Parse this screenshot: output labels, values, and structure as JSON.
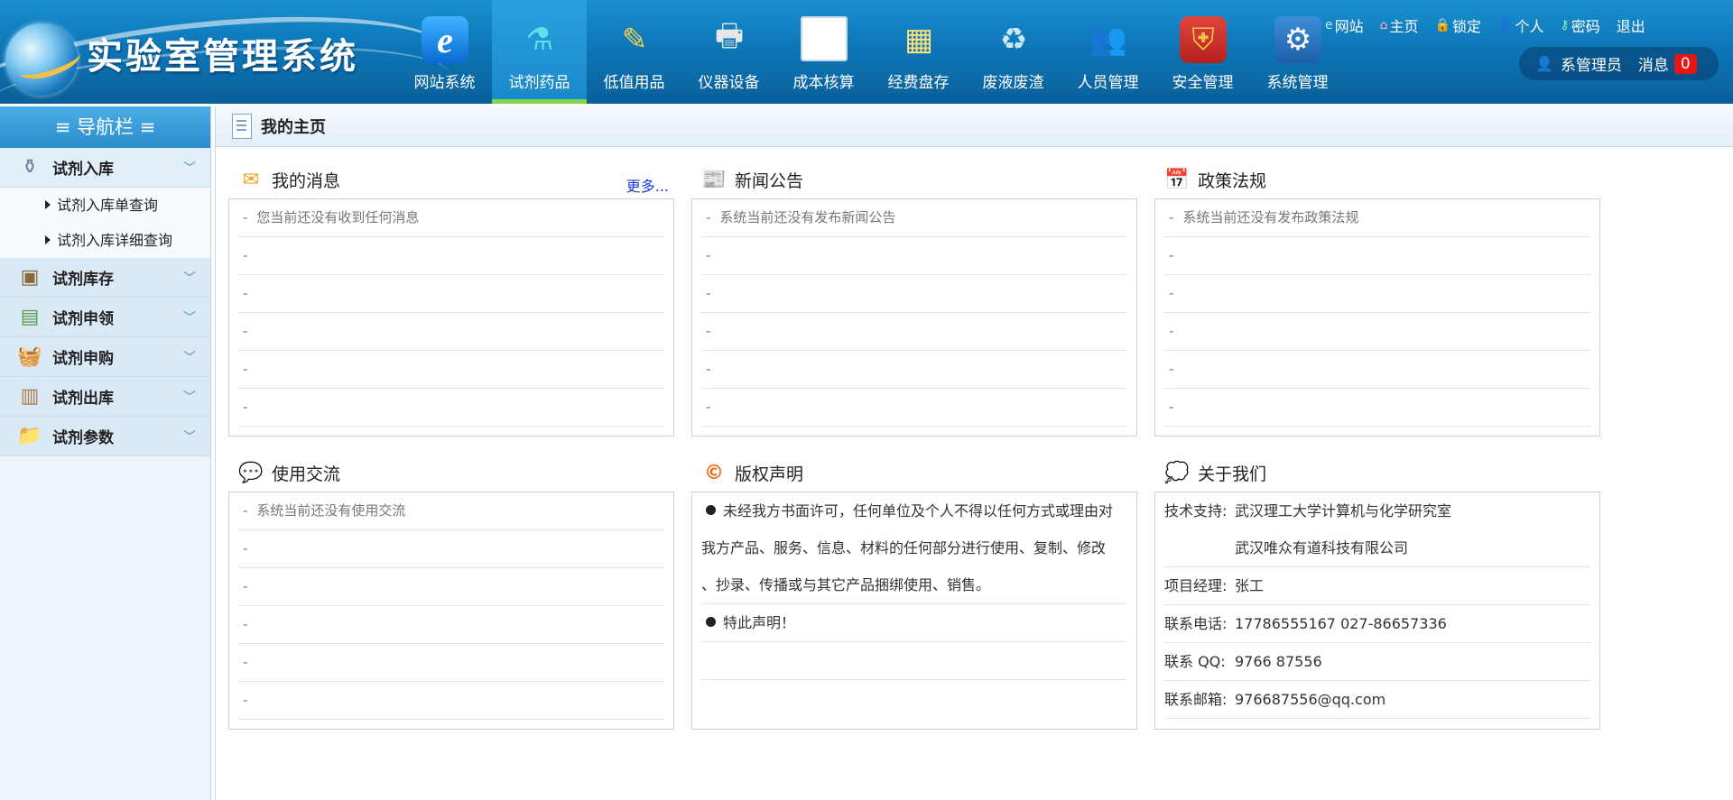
{
  "app": {
    "title": "实验室管理系统"
  },
  "main_nav": [
    {
      "label": "网站系统",
      "icon": "ie-browser-icon"
    },
    {
      "label": "试剂药品",
      "icon": "flask-icon",
      "active": true
    },
    {
      "label": "低值用品",
      "icon": "dropper-icon"
    },
    {
      "label": "仪器设备",
      "icon": "instrument-icon"
    },
    {
      "label": "成本核算",
      "icon": "spreadsheet-icon"
    },
    {
      "label": "经费盘存",
      "icon": "money-calculator-icon"
    },
    {
      "label": "废液废渣",
      "icon": "recycle-bin-icon"
    },
    {
      "label": "人员管理",
      "icon": "people-icon"
    },
    {
      "label": "安全管理",
      "icon": "shield-icon"
    },
    {
      "label": "系统管理",
      "icon": "gear-icon"
    }
  ],
  "top_links": [
    {
      "label": "网站",
      "icon": "ie-small-icon"
    },
    {
      "label": "主页",
      "icon": "home-icon"
    },
    {
      "label": "锁定",
      "icon": "lock-icon"
    },
    {
      "label": "个人",
      "icon": "person-icon"
    },
    {
      "label": "密码",
      "icon": "key-icon"
    },
    {
      "label": "退出",
      "icon": ""
    }
  ],
  "user": {
    "name": "系管理员",
    "message_label": "消息",
    "message_count": "0"
  },
  "sidebar": {
    "title": "≡ 导航栏 ≡",
    "groups": [
      {
        "label": "试剂入库",
        "icon": "reagent-in-icon",
        "open": true,
        "items": [
          "试剂入库单查询",
          "试剂入库详细查询"
        ]
      },
      {
        "label": "试剂库存",
        "icon": "inventory-icon"
      },
      {
        "label": "试剂申领",
        "icon": "requisition-icon"
      },
      {
        "label": "试剂申购",
        "icon": "purchase-basket-icon"
      },
      {
        "label": "试剂出库",
        "icon": "reagent-out-icon"
      },
      {
        "label": "试剂参数",
        "icon": "parameter-folder-icon"
      }
    ]
  },
  "main": {
    "title": "我的主页",
    "panels": {
      "messages": {
        "title": "我的消息",
        "more": "更多...",
        "rows": [
          "您当前还没有收到任何消息",
          "",
          "",
          "",
          "",
          ""
        ]
      },
      "news": {
        "title": "新闻公告",
        "rows": [
          "系统当前还没有发布新闻公告",
          "",
          "",
          "",
          "",
          ""
        ]
      },
      "policy": {
        "title": "政策法规",
        "rows": [
          "系统当前还没有发布政策法规",
          "",
          "",
          "",
          "",
          ""
        ]
      },
      "exchange": {
        "title": "使用交流",
        "rows": [
          "系统当前还没有使用交流",
          "",
          "",
          "",
          "",
          ""
        ]
      },
      "copyright": {
        "title": "版权声明",
        "line1": "未经我方书面许可，任何单位及个人不得以任何方式或理由对",
        "line2": "我方产品、服务、信息、材料的任何部分进行使用、复制、修改",
        "line3": "、抄录、传播或与其它产品捆绑使用、销售。",
        "line4": "特此声明！"
      },
      "about": {
        "title": "关于我们",
        "support_key": "技术支持:",
        "support_1": "武汉理工大学计算机与化学研究室",
        "support_2": "武汉唯众有道科技有限公司",
        "manager_key": "项目经理:",
        "manager": "张工",
        "phone_key": "联系电话:",
        "phone": "17786555167 027-86657336",
        "qq_key": "联系 QQ:",
        "qq": "9766 87556",
        "email_key": "联系邮箱:",
        "email": "976687556@qq.com"
      }
    }
  }
}
